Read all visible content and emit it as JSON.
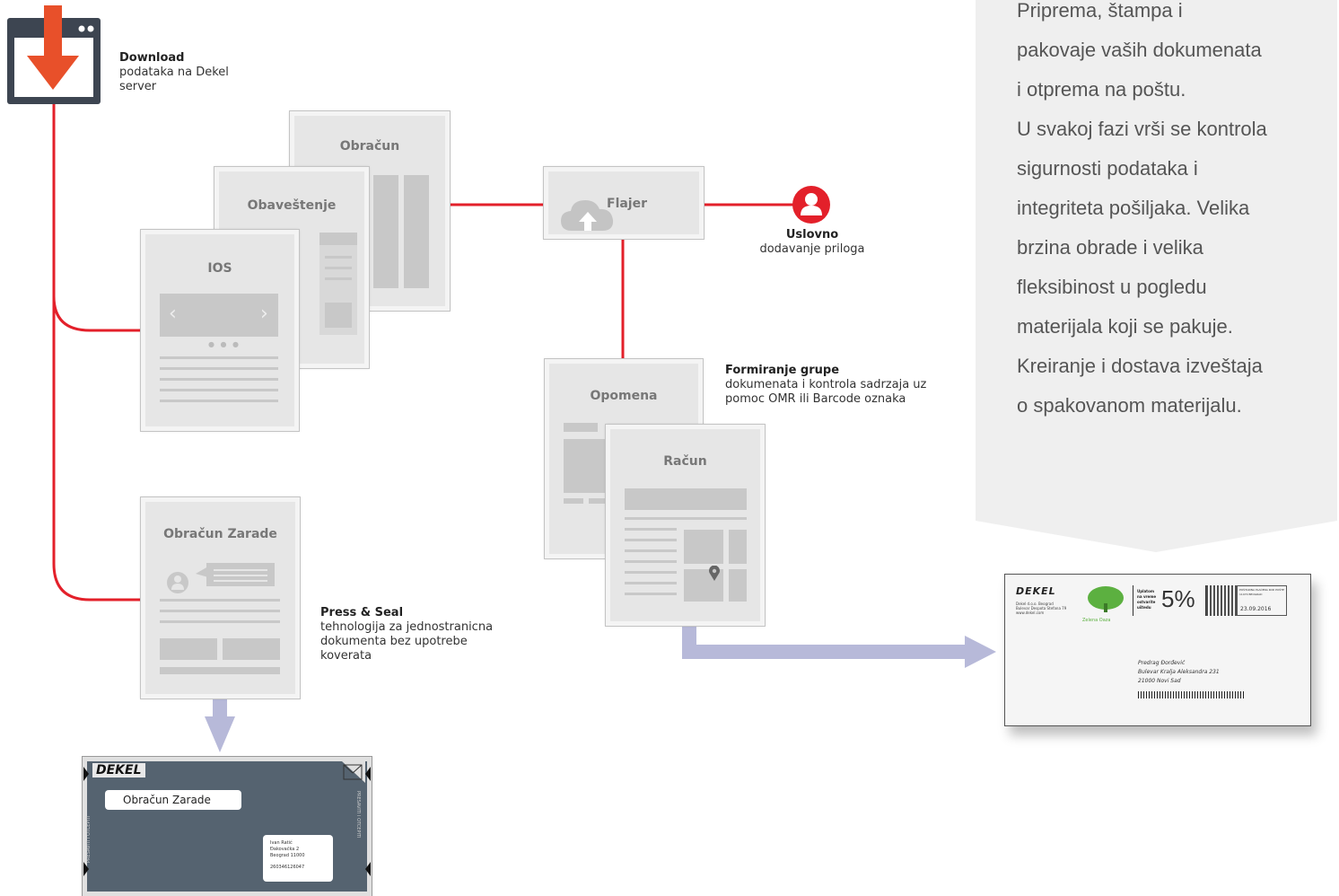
{
  "download": {
    "title": "Download",
    "text": "podataka na Dekel server",
    "icon": "download-icon"
  },
  "documents": {
    "obracun": "Obračun",
    "obavestenje": "Obaveštenje",
    "ios": "IOS",
    "flajer": "Flajer",
    "opomena": "Opomena",
    "racun": "Račun",
    "obracun_zarade": "Obračun Zarade"
  },
  "uslovno": {
    "title": "Uslovno",
    "text": "dodavanje priloga",
    "icon": "user-icon"
  },
  "formiranje": {
    "title": "Formiranje grupe",
    "text": "dokumenata i kontrola sadrzaja uz pomoc OMR ili Barcode oznaka"
  },
  "press_seal": {
    "title": "Press & Seal",
    "text": "tehnologija za jednostranicna dokumenta bez upotrebe koverata"
  },
  "panel": {
    "lines": [
      "Priprema, štampa i",
      "pakovaje vaših dokumenata",
      "i otprema na poštu.",
      "U svakoj fazi vrši se kontrola",
      "sigurnosti podataka i",
      "integriteta pošiljaka. Velika",
      "brzina obrade i velika",
      "fleksibinost u pogledu",
      "materijala koji se pakuje.",
      "Kreiranje i dostava izveštaja",
      "o spakovanom materijalu."
    ]
  },
  "envelope": {
    "brand": "DEKEL",
    "sender": [
      "Dekel d.o.o. Beograd",
      "Bulevar Despota Stefana 79",
      "www.dekel.com"
    ],
    "tree_label": "Zelena Oaza",
    "promo_text": [
      "Uplatom",
      "na vreme",
      "ostvarite",
      "uštedu"
    ],
    "discount": "5%",
    "postage_header": "POŠTARINA PLAĆENA KOD POŠTE 11070 BEOGRAD",
    "date": "23.09.2016",
    "recipient": [
      "Predrag Đorđević",
      "Bulevar Kralja Aleksandra 231",
      "21000 Novi Sad"
    ]
  },
  "press_seal_item": {
    "brand": "DEKEL",
    "label": "Obračun Zarade",
    "address": [
      "Ivan Ratić",
      "Đakovačka 2",
      "Beograd 11000"
    ],
    "code": "260346126047",
    "side_text": "PRESAVITI I OTCEPITI"
  },
  "colors": {
    "connector": "#e3202a",
    "arrow": "#b7b9d9",
    "doc_fill": "#e6e6e6",
    "panel": "#efefef",
    "download_arrow": "#e8502a",
    "window": "#3d4551"
  }
}
